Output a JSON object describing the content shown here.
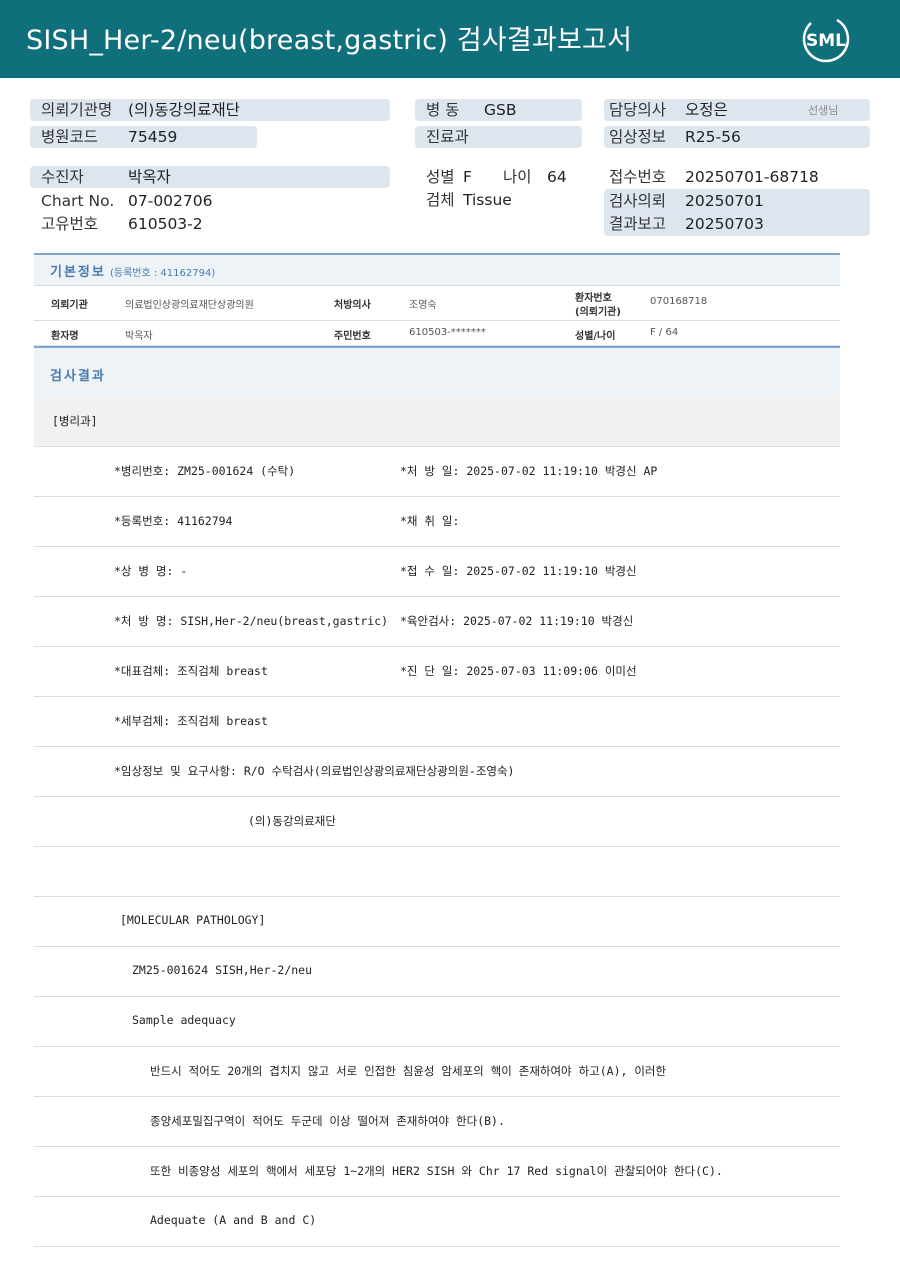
{
  "header": {
    "title": "SISH_Her-2/neu(breast,gastric) 검사결과보고서",
    "logo_text": "SML",
    "logo_icon": "sml-logo-icon",
    "bg_color": "#0f6f7a"
  },
  "summary": {
    "institution_label": "의뢰기관명",
    "institution_value": "(의)동강의료재단",
    "hospital_code_label": "병원코드",
    "hospital_code_value": "75459",
    "ward_label": "병 동",
    "ward_value": "GSB",
    "department_label": "진료과",
    "department_value": "",
    "doctor_label": "담당의사",
    "doctor_value": "오정은",
    "doctor_suffix": "선생님",
    "clinical_info_label": "임상정보",
    "clinical_info_value": "R25-56",
    "patient_label": "수진자",
    "patient_value": "박옥자",
    "chart_label": "Chart No.",
    "chart_value": "07-002706",
    "unique_no_label": "고유번호",
    "unique_no_value": "610503-2",
    "sex_label": "성별",
    "sex_value": "F",
    "age_label": "나이",
    "age_value": "64",
    "specimen_label": "검체",
    "specimen_value": "Tissue",
    "receipt_no_label": "접수번호",
    "receipt_no_value": "20250701-68718",
    "request_label": "검사의뢰",
    "request_value": "20250701",
    "result_label": "결과보고",
    "result_value": "20250703"
  },
  "basic_info": {
    "title": "기본정보",
    "reg_no": "(등록번호 : 41162794)",
    "rows": [
      {
        "k1": "의뢰기관",
        "v1": "의료법인상광의료재단상광의원",
        "k2": "처방의사",
        "v2": "조영숙",
        "k3a": "환자번호",
        "k3b": "(의뢰기관)",
        "v3": "070168718"
      },
      {
        "k1": "환자명",
        "v1": "박옥자",
        "k2": "주민번호",
        "v2": "610503-*******",
        "k3a": "성별/나이",
        "k3b": "",
        "v3": "F / 64"
      }
    ]
  },
  "result": {
    "title": "검사결과",
    "lines": [
      {
        "a": "[병리과]",
        "b": ""
      },
      {
        "a": "*병리번호: ZM25-001624 (수탁)",
        "b": "*처 방 일: 2025-07-02 11:19:10  박경신 AP"
      },
      {
        "a": "*등록번호: 41162794",
        "b": "*채 취 일:"
      },
      {
        "a": "*상 병 명: -",
        "b": "*접 수 일: 2025-07-02 11:19:10  박경신"
      },
      {
        "a": "*처 방 명: SISH,Her-2/neu(breast,gastric)",
        "b": "*육안검사: 2025-07-02 11:19:10  박경신"
      },
      {
        "a": "*대표검체: 조직검체 breast",
        "b": "*진 단 일: 2025-07-03 11:09:06  이미선"
      },
      {
        "a": "*세부검체: 조직검체 breast",
        "b": ""
      },
      {
        "a": "*임상정보 및 요구사항: R/O 수탁검사(의료법인상광의료재단상광의원-조영숙)",
        "b": ""
      },
      {
        "a": "(의)동강의료재단",
        "b": ""
      },
      {
        "a": "",
        "b": ""
      },
      {
        "a": "[MOLECULAR PATHOLOGY]",
        "b": ""
      },
      {
        "a": "ZM25-001624     SISH,Her-2/neu",
        "b": ""
      },
      {
        "a": "Sample adequacy",
        "b": ""
      },
      {
        "a": "반드시 적어도 20개의 겹치지 않고 서로 인접한 침윤성 암세포의 핵이 존재하여야 하고(A), 이러한",
        "b": ""
      },
      {
        "a": "종양세포밀집구역이 적어도 두군데 이상 떨어져 존재하여야 한다(B).",
        "b": ""
      },
      {
        "a": "또한 비종양성 세포의 핵에서 세포당 1~2개의 HER2 SISH 와 Chr 17 Red signal이 관찰되어야 한다(C).",
        "b": ""
      },
      {
        "a": "Adequate (A and B and C)",
        "b": ""
      }
    ]
  }
}
